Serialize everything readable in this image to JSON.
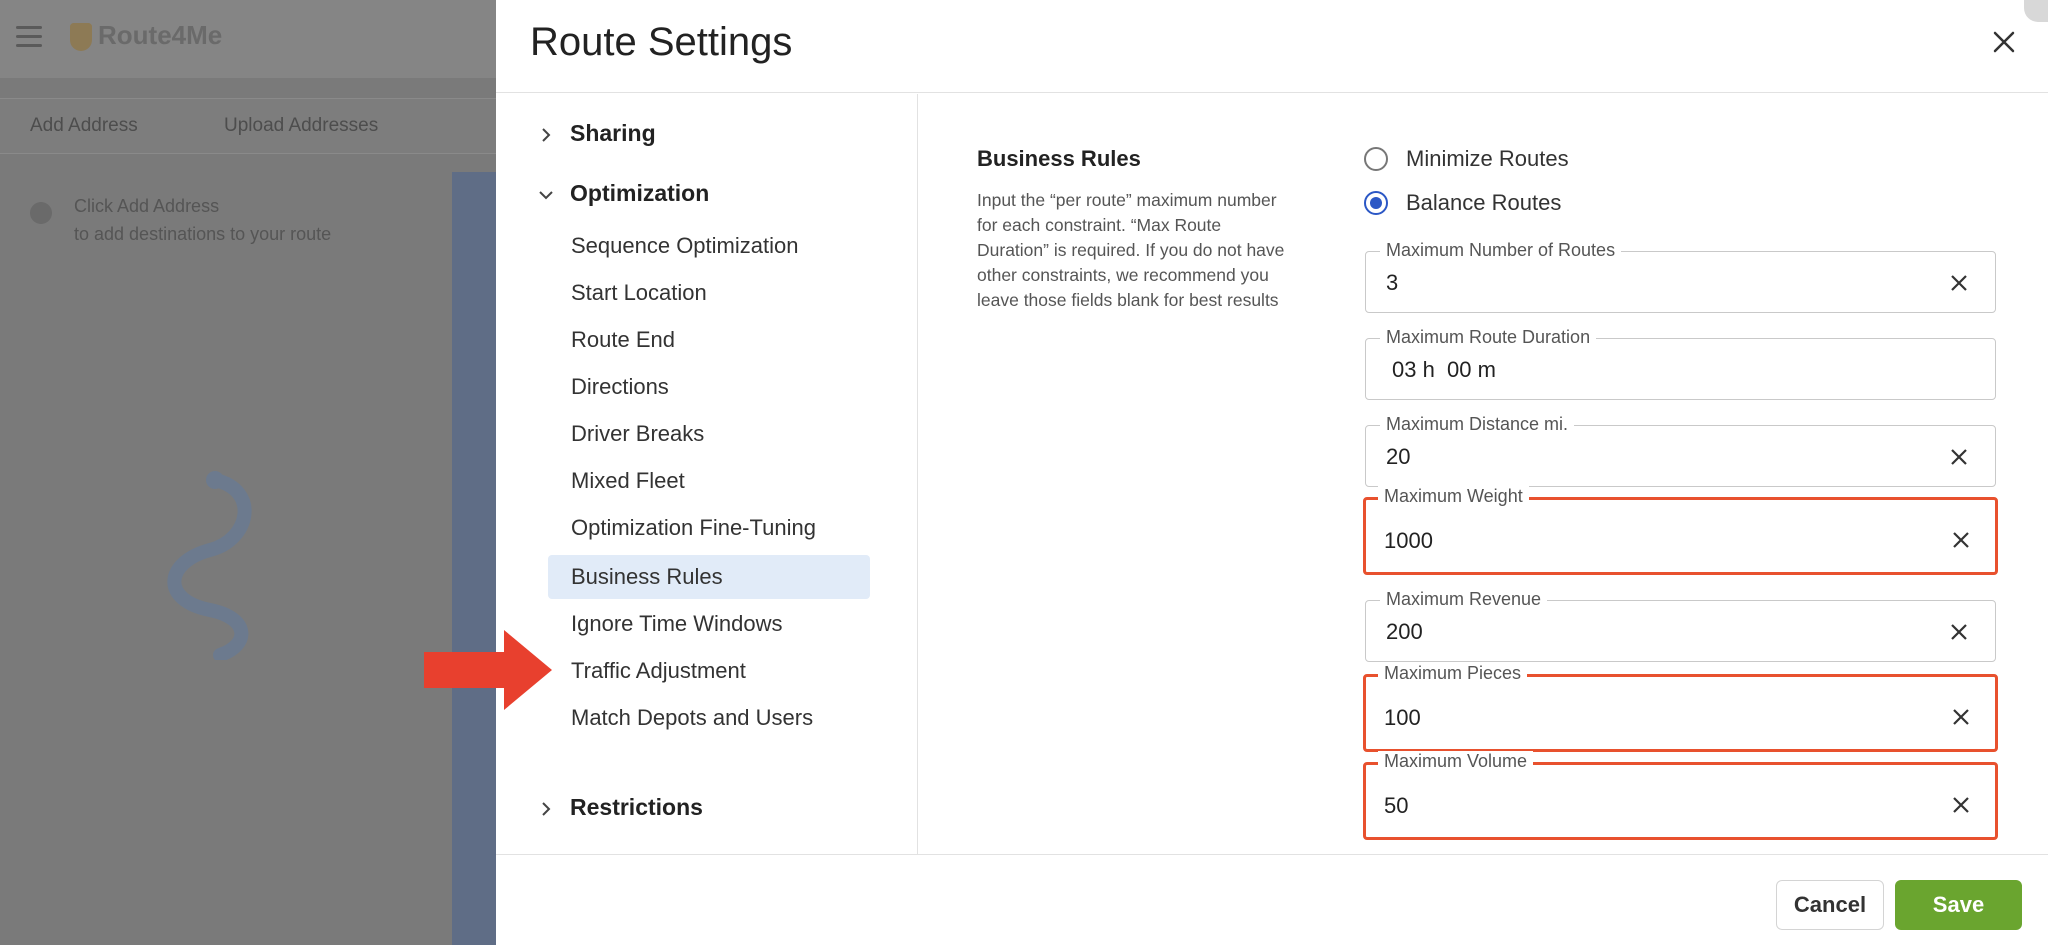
{
  "background": {
    "logo_text": "Route4Me",
    "toolbar": [
      "Add Address",
      "Upload Addresses"
    ],
    "hint_line1": "Click Add Address",
    "hint_line2": "to add destinations to your route"
  },
  "modal": {
    "title": "Route Settings",
    "sidebar": {
      "sections": [
        {
          "label": "Sharing",
          "expanded": false
        },
        {
          "label": "Optimization",
          "expanded": true
        },
        {
          "label": "Restrictions",
          "expanded": false
        }
      ],
      "items": [
        "Sequence Optimization",
        "Start Location",
        "Route End",
        "Directions",
        "Driver Breaks",
        "Mixed Fleet",
        "Optimization Fine-Tuning",
        "Business Rules",
        "Ignore Time Windows",
        "Traffic Adjustment",
        "Match Depots and Users"
      ],
      "active_item": "Business Rules"
    },
    "content": {
      "title": "Business Rules",
      "description": "Input the “per route” maximum number for each constraint. “Max Route Duration” is required. If you do not have other constraints, we recommend you leave those fields blank for best results",
      "options": [
        {
          "label": "Minimize Routes",
          "checked": false
        },
        {
          "label": "Balance Routes",
          "checked": true
        }
      ],
      "fields": [
        {
          "label": "Maximum Number of Routes",
          "value": "3",
          "highlighted": false
        },
        {
          "label": "Maximum Route Duration",
          "value": "03 h  00 m",
          "highlighted": false
        },
        {
          "label": "Maximum Distance mi.",
          "value": "20",
          "highlighted": false
        },
        {
          "label": "Maximum Weight",
          "value": "1000",
          "highlighted": true
        },
        {
          "label": "Maximum Revenue",
          "value": "200",
          "highlighted": false
        },
        {
          "label": "Maximum Pieces",
          "value": "100",
          "highlighted": true
        },
        {
          "label": "Maximum Volume",
          "value": "50",
          "highlighted": true
        }
      ]
    },
    "footer": {
      "cancel_label": "Cancel",
      "save_label": "Save"
    }
  },
  "colors": {
    "accent": "#2b57c5",
    "highlight_border": "#e8512e",
    "save_button": "#6aa52f",
    "active_nav_bg": "#e1ebf8",
    "arrow": "#e8402e"
  }
}
